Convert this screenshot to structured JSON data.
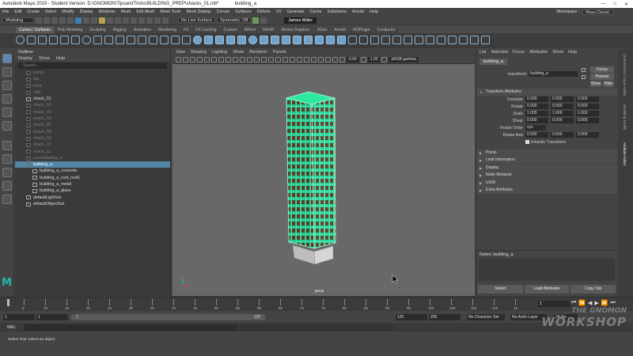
{
  "window": {
    "title": "Autodesk Maya 2019 - Student Version: D:\\GNOMON\\TipsandTricks\\BUILDING_PREP\\shacks_01.mb*",
    "selected_object": "building_a",
    "controls": [
      "—",
      "□",
      "✕"
    ]
  },
  "menubar": {
    "items": [
      "File",
      "Edit",
      "Create",
      "Select",
      "Modify",
      "Display",
      "Windows",
      "Mesh",
      "Edit Mesh",
      "Mesh Tools",
      "Mesh Display",
      "Curves",
      "Surfaces",
      "Deform",
      "UV",
      "Generate",
      "Cache",
      "Substance",
      "Arnold",
      "Help"
    ],
    "workspace_label": "Workspace :",
    "workspace_value": "Maya Classic"
  },
  "statusline": {
    "mode": "Modeling",
    "live_surface": "No Live Surface",
    "symmetry": "Symmetry: Off",
    "user": "James Miller"
  },
  "shelf": {
    "tabs": [
      "Curves / Surfaces",
      "Poly Modeling",
      "Sculpting",
      "Rigging",
      "Animation",
      "Rendering",
      "FX",
      "FX Caching",
      "Custom",
      "Bifrost",
      "MASH",
      "Motion Graphics",
      "XGen",
      "Arnold",
      "MSPlugin",
      "Conductor"
    ],
    "active_tab": 0
  },
  "outliner": {
    "title": "Outliner",
    "menu": [
      "Display",
      "Show",
      "Help"
    ],
    "search_placeholder": "Search...",
    "items": [
      {
        "label": "persp",
        "state": "dim",
        "indent": 0
      },
      {
        "label": "top",
        "state": "dim",
        "indent": 0
      },
      {
        "label": "front",
        "state": "dim",
        "indent": 0
      },
      {
        "label": "side",
        "state": "dim",
        "indent": 0
      },
      {
        "label": "shack_01",
        "state": "vis",
        "indent": 0
      },
      {
        "label": "shack_02",
        "state": "dim",
        "indent": 0
      },
      {
        "label": "shack_03",
        "state": "dim",
        "indent": 0
      },
      {
        "label": "shack_04",
        "state": "dim",
        "indent": 0
      },
      {
        "label": "shack_05",
        "state": "dim",
        "indent": 0
      },
      {
        "label": "shack_08",
        "state": "dim",
        "indent": 0
      },
      {
        "label": "shack_09",
        "state": "dim",
        "indent": 0
      },
      {
        "label": "shack_10",
        "state": "dim",
        "indent": 0
      },
      {
        "label": "shack_11",
        "state": "dim",
        "indent": 0
      },
      {
        "label": "consolidating_a",
        "state": "dim",
        "indent": 0
      },
      {
        "label": "building_a",
        "state": "selected",
        "indent": 0
      },
      {
        "label": "building_a_concrete",
        "state": "vis",
        "indent": 1
      },
      {
        "label": "building_a_roof_roof1",
        "state": "vis",
        "indent": 1
      },
      {
        "label": "building_a_metal",
        "state": "vis",
        "indent": 1
      },
      {
        "label": "building_a_glass",
        "state": "vis",
        "indent": 1
      },
      {
        "label": "defaultLightSet",
        "state": "vis",
        "indent": 0
      },
      {
        "label": "defaultObjectSet",
        "state": "vis",
        "indent": 0
      }
    ]
  },
  "viewport": {
    "menu": [
      "View",
      "Shading",
      "Lighting",
      "Show",
      "Renderer",
      "Panels"
    ],
    "near": "0.00",
    "far": "1.00",
    "colorspace": "sRGB gamma",
    "camera": "persp"
  },
  "attribute_editor": {
    "menu": [
      "List",
      "Selected",
      "Focus",
      "Attributes",
      "Show",
      "Help"
    ],
    "node_tab": "building_a",
    "transform_label": "transform:",
    "transform_value": "building_a",
    "buttons": {
      "focus": "Focus",
      "presets": "Presets",
      "show": "Show",
      "hide": "Hide"
    },
    "section_title": "Transform Attributes",
    "rows": [
      {
        "label": "Translate",
        "values": [
          "0.000",
          "0.000",
          "0.000"
        ]
      },
      {
        "label": "Rotate",
        "values": [
          "0.000",
          "0.000",
          "0.000"
        ]
      },
      {
        "label": "Scale",
        "values": [
          "1.000",
          "1.000",
          "1.000"
        ]
      },
      {
        "label": "Shear",
        "values": [
          "0.000",
          "0.000",
          "0.000"
        ]
      }
    ],
    "rotate_order_label": "Rotate Order",
    "rotate_order_value": "xyz",
    "rotate_axis_label": "Rotate Axis",
    "rotate_axis_values": [
      "0.000",
      "0.000",
      "0.000"
    ],
    "inherits": "Inherits Transform",
    "sections": [
      "Pivots",
      "Limit Information",
      "Display",
      "Node Behavior",
      "UUID",
      "Extra Attributes"
    ],
    "notes_label": "Notes:",
    "notes_node": "building_a",
    "bottom_buttons": [
      "Select",
      "Load Attributes",
      "Copy Tab"
    ]
  },
  "side_tabs": [
    "Channel Box / Layer Editor",
    "Modeling Toolkit",
    "Attribute Editor"
  ],
  "timeslider": {
    "ticks": [
      "5",
      "10",
      "15",
      "20",
      "25",
      "30",
      "35",
      "40",
      "45",
      "50",
      "55",
      "60",
      "65",
      "70",
      "75",
      "80",
      "85",
      "90",
      "95",
      "100",
      "105",
      "110",
      "115",
      "12"
    ],
    "current_frame": "1"
  },
  "range": {
    "start": "1",
    "playback_start": "1",
    "bar_start": "1",
    "bar_end": "120",
    "playback_end": "120",
    "end": "200",
    "character_set": "No Character Set",
    "anim_layer": "No Anim Layer",
    "fps": "24 fps"
  },
  "cmdline": {
    "label": "MEL"
  },
  "helpline": {
    "text": "Select Tool: select an object"
  },
  "watermark": {
    "line1": "THE GNOMON",
    "line2": "WORKSHOP"
  },
  "colors": {
    "accent": "#5285a6",
    "wire": "#2ee8a0",
    "maya_logo": "#1fb7a8"
  }
}
